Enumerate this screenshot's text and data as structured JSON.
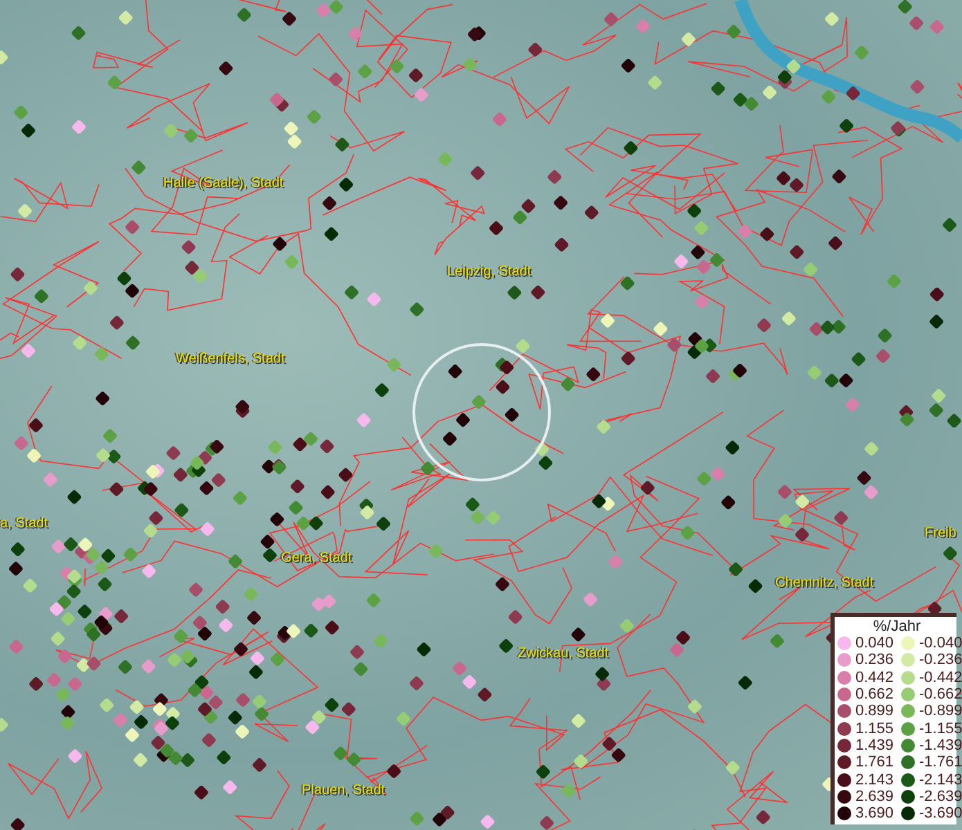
{
  "map": {
    "places": [
      {
        "label": "Halle (Saale), Stadt"
      },
      {
        "label": "Leipzig, Stadt"
      },
      {
        "label": "Weißenfels, Stadt"
      },
      {
        "label": "a, Stadt"
      },
      {
        "label": "Gera, Stadt"
      },
      {
        "label": "Chemnitz, Stadt"
      },
      {
        "label": "Zwickau, Stadt"
      },
      {
        "label": "Plauen, Stadt"
      },
      {
        "label": "Freib"
      }
    ]
  },
  "legend": {
    "title": "%/Jahr",
    "positive": [
      {
        "label": "0.040",
        "color": "#f7b8ee"
      },
      {
        "label": "0.236",
        "color": "#e89ccc"
      },
      {
        "label": "0.442",
        "color": "#d87fac"
      },
      {
        "label": "0.662",
        "color": "#c8688e"
      },
      {
        "label": "0.899",
        "color": "#a84e6a"
      },
      {
        "label": "1.155",
        "color": "#8e3a50"
      },
      {
        "label": "1.439",
        "color": "#76283a"
      },
      {
        "label": "1.761",
        "color": "#5e1a26"
      },
      {
        "label": "2.143",
        "color": "#4a0e18"
      },
      {
        "label": "2.639",
        "color": "#360810"
      },
      {
        "label": "3.690",
        "color": "#220408"
      }
    ],
    "negative": [
      {
        "label": "-0.040",
        "color": "#eef5b8"
      },
      {
        "label": "-0.236",
        "color": "#d2eaa4"
      },
      {
        "label": "-0.442",
        "color": "#b4dc8c"
      },
      {
        "label": "-0.662",
        "color": "#96cc74"
      },
      {
        "label": "-0.899",
        "color": "#78b85a"
      },
      {
        "label": "-1.155",
        "color": "#5ca244"
      },
      {
        "label": "-1.439",
        "color": "#448a34"
      },
      {
        "label": "-1.761",
        "color": "#2e7026"
      },
      {
        "label": "-2.143",
        "color": "#1c5818"
      },
      {
        "label": "-2.639",
        "color": "#0e400c"
      },
      {
        "label": "-3.690",
        "color": "#062a06"
      }
    ]
  }
}
